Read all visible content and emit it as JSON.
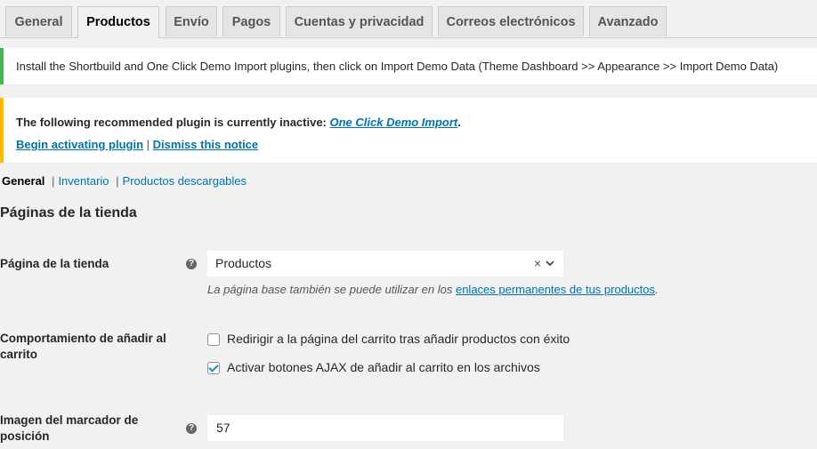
{
  "tabs": [
    {
      "label": "General"
    },
    {
      "label": "Productos",
      "active": true
    },
    {
      "label": "Envío"
    },
    {
      "label": "Pagos"
    },
    {
      "label": "Cuentas y privacidad"
    },
    {
      "label": "Correos electrónicos"
    },
    {
      "label": "Avanzado"
    }
  ],
  "notice_install": {
    "text": "Install the Shortbuild and One Click Demo Import plugins, then click on Import Demo Data (Theme Dashboard >> Appearance >> Import Demo Data)"
  },
  "notice_plugin": {
    "text_before": "The following recommended plugin is currently inactive: ",
    "plugin_link": "One Click Demo Import",
    "text_after": ".",
    "begin_link": "Begin activating plugin",
    "separator": "|",
    "dismiss_link": "Dismiss this notice"
  },
  "subsections": {
    "current": "General",
    "items": [
      "Inventario",
      "Productos descargables"
    ],
    "separator": "|"
  },
  "section_title": "Páginas de la tienda",
  "shop_page": {
    "label": "Página de la tienda",
    "help_icon": "?",
    "selected_value": "Productos",
    "clear_icon": "×",
    "chevron_icon": "⌄",
    "description_before": "La página base también se puede utilizar en los ",
    "description_link": "enlaces permanentes de tus productos",
    "description_after": "."
  },
  "add_to_cart": {
    "label": "Comportamiento de añadir al carrito",
    "options": [
      {
        "label": "Redirigir a la página del carrito tras añadir productos con éxito",
        "checked": false
      },
      {
        "label": "Activar botones AJAX de añadir al carrito en los archivos",
        "checked": true
      }
    ]
  },
  "placeholder_image": {
    "label": "Imagen del marcador de posición",
    "help_icon": "?",
    "value": "57"
  },
  "colors": {
    "link": "#0073aa",
    "notice_success": "#46b450",
    "notice_warning": "#ffb900",
    "background": "#f1f1f1"
  }
}
